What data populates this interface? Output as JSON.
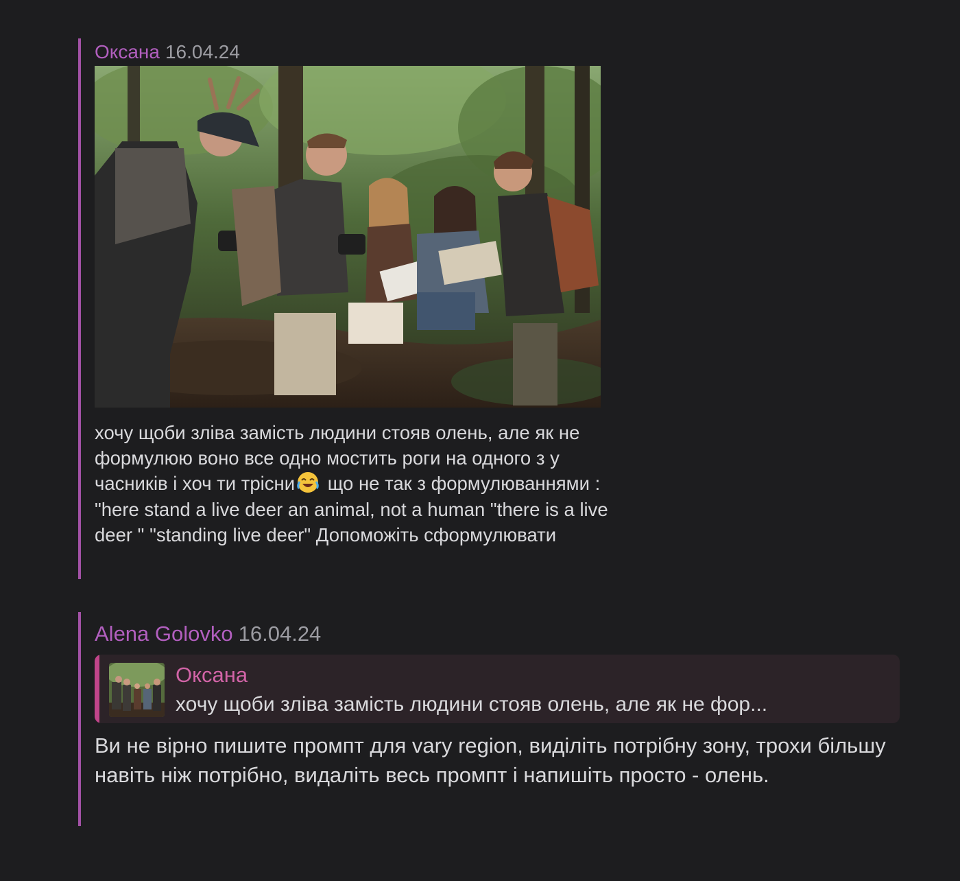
{
  "messages": [
    {
      "author": "Оксана",
      "date": "16.04.24",
      "text_before_emoji": "хочу щоби зліва замість людини стояв олень, але як не формулюю воно все одно мостить роги на одного з у часників і хоч ти трісни",
      "emoji": "face-with-tears-of-joy",
      "text_after_emoji": " що не так з формулюваннями : \"here stand a live deer an animal, not a human \"there is a live deer \" \"standing live deer\" Допоможіть сформулювати"
    },
    {
      "author": "Alena Golovko",
      "date": "16.04.24",
      "reply": {
        "author": "Оксана",
        "text": "хочу щоби зліва замість людини стояв олень, але як не фор..."
      },
      "text": "Ви не вірно пишите промпт для vary region, виділіть потрібну зону, трохи більшу навіть ніж потрібно, видаліть весь промпт і напишіть просто - олень."
    }
  ],
  "colors": {
    "background": "#1d1d1f",
    "author": "#b25fbf",
    "accent_bar": "#a352a6",
    "reply_author": "#d264a7",
    "reply_bar": "#c0458a",
    "reply_bg": "#2c2328",
    "date": "#9c9ca2",
    "text": "#d9d9dc"
  }
}
